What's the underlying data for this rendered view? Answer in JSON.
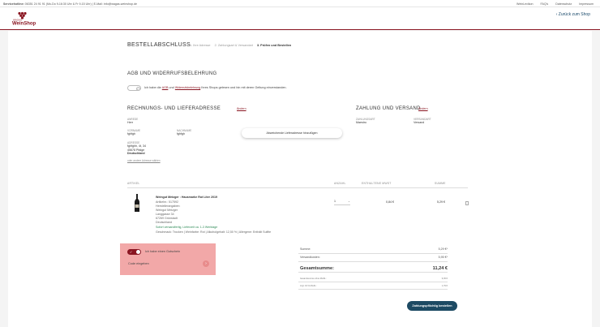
{
  "topbar": {
    "label": "Servicehotline:",
    "contact": "06351 24 91 91 (Mo-Do 9-16:30 Uhr & Fr 9-15 Uhr) | E-Mail: info@wagas-weinshop.de",
    "links": [
      "WeinLexikon",
      "FAQ's",
      "Datenschutz",
      "Impressum"
    ]
  },
  "header": {
    "logo_top": "WAGAS",
    "logo_main": "WeinShop",
    "back": "‹ Zurück zum Shop"
  },
  "checkout": {
    "title": "BESTELLABSCHLUSS",
    "steps": [
      "1. Ihre Adresse",
      "2. Zahlungsart & Versandart",
      "3. Prüfen und Bestellen"
    ],
    "active_step": 2
  },
  "agb": {
    "title": "AGB UND WIDERRUFSBELEHRUNG",
    "text_1": "Ich habe die",
    "agb_link": "AGB",
    "text_2": "und",
    "widerruf_link": "Widerrufsbelehrung",
    "text_3": "Ihres Shops gelesen und bin mit deren Geltung einverstanden.",
    "toggle_mark": "✕"
  },
  "address": {
    "title": "RECHNUNGS- UND LIEFERADRESSE",
    "edit": "Ändern",
    "anrede_label": "ANREDE",
    "anrede": "Herr",
    "vorname_label": "VORNAME",
    "vorname": "fghfgh",
    "nachname_label": "NACHNAME",
    "nachname": "fghfgh",
    "adresse_label": "ADRESSE",
    "adresse_lines": [
      "fghfghh, 4t, 34",
      "45678 Pfalge",
      "Deutschland"
    ],
    "other_link": "oder andere Adresse wählen",
    "alt_delivery_button": "Abweichende Lieferadresse hinzufügen"
  },
  "payment": {
    "title": "ZAHLUNG UND VERSAND",
    "edit": "Ändern",
    "zahlungsart_label": "ZAHLUNGSART",
    "zahlungsart": "Maestro",
    "versandart_label": "VERSANDART",
    "versandart": "Versand"
  },
  "table": {
    "headers": [
      "ARTIKEL",
      "ANZAHL",
      "ENTHALTENE MWST",
      "SUMME"
    ],
    "item": {
      "name": "Weingut Metzger : Hausmarke Rot Liter 2019",
      "lines": [
        "Artikelnr.: 517592",
        "Herstellerangaben:",
        "Weingut Metzger",
        "Langgasse 34",
        "67269 Grünstadt",
        "Deutschland"
      ],
      "availability": "Sofort versandfertig, Lieferzeit ca. 1-3 Werktage",
      "specs": "Geschmack: Trocken  |  Weinfarbe: Rot  |  Alkoholgehalt: 12,50 %  |  Allergene: Enthält Sulfite",
      "qty": "1",
      "mwst": "0,84 €",
      "sum": "5,29 €"
    }
  },
  "voucher": {
    "label": "Ich habe einen Gutschein",
    "code": "Code eingeben",
    "arrow": "›"
  },
  "summary": {
    "summe_label": "Summe:",
    "summe": "5,29 €*",
    "versand_label": "Versandkosten:",
    "versand": "5,95 €*",
    "gesamt_label": "Gesamtsumme:",
    "gesamt": "11,24 €",
    "netto_label": "Gesamtsumme ohne MwSt.:",
    "netto": "9,45 €",
    "mwst_label": "zzgl. 19 % MwSt.:",
    "mwst": "1,79 €"
  },
  "order_button": "Zahlungspflichtig bestellen",
  "colors": {
    "brand": "#8a1622",
    "button": "#1d4a63",
    "voucher_bg": "#f2a8a8"
  }
}
